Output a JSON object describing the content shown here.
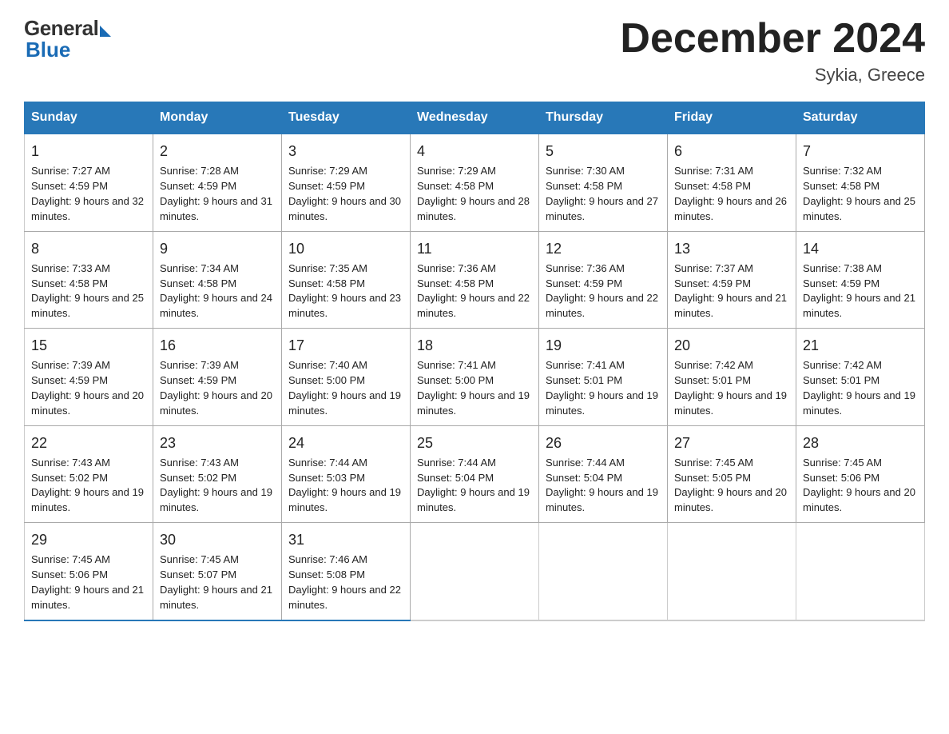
{
  "logo": {
    "general": "General",
    "blue": "Blue"
  },
  "title": "December 2024",
  "location": "Sykia, Greece",
  "days_of_week": [
    "Sunday",
    "Monday",
    "Tuesday",
    "Wednesday",
    "Thursday",
    "Friday",
    "Saturday"
  ],
  "weeks": [
    [
      {
        "day": "1",
        "sunrise": "Sunrise: 7:27 AM",
        "sunset": "Sunset: 4:59 PM",
        "daylight": "Daylight: 9 hours and 32 minutes."
      },
      {
        "day": "2",
        "sunrise": "Sunrise: 7:28 AM",
        "sunset": "Sunset: 4:59 PM",
        "daylight": "Daylight: 9 hours and 31 minutes."
      },
      {
        "day": "3",
        "sunrise": "Sunrise: 7:29 AM",
        "sunset": "Sunset: 4:59 PM",
        "daylight": "Daylight: 9 hours and 30 minutes."
      },
      {
        "day": "4",
        "sunrise": "Sunrise: 7:29 AM",
        "sunset": "Sunset: 4:58 PM",
        "daylight": "Daylight: 9 hours and 28 minutes."
      },
      {
        "day": "5",
        "sunrise": "Sunrise: 7:30 AM",
        "sunset": "Sunset: 4:58 PM",
        "daylight": "Daylight: 9 hours and 27 minutes."
      },
      {
        "day": "6",
        "sunrise": "Sunrise: 7:31 AM",
        "sunset": "Sunset: 4:58 PM",
        "daylight": "Daylight: 9 hours and 26 minutes."
      },
      {
        "day": "7",
        "sunrise": "Sunrise: 7:32 AM",
        "sunset": "Sunset: 4:58 PM",
        "daylight": "Daylight: 9 hours and 25 minutes."
      }
    ],
    [
      {
        "day": "8",
        "sunrise": "Sunrise: 7:33 AM",
        "sunset": "Sunset: 4:58 PM",
        "daylight": "Daylight: 9 hours and 25 minutes."
      },
      {
        "day": "9",
        "sunrise": "Sunrise: 7:34 AM",
        "sunset": "Sunset: 4:58 PM",
        "daylight": "Daylight: 9 hours and 24 minutes."
      },
      {
        "day": "10",
        "sunrise": "Sunrise: 7:35 AM",
        "sunset": "Sunset: 4:58 PM",
        "daylight": "Daylight: 9 hours and 23 minutes."
      },
      {
        "day": "11",
        "sunrise": "Sunrise: 7:36 AM",
        "sunset": "Sunset: 4:58 PM",
        "daylight": "Daylight: 9 hours and 22 minutes."
      },
      {
        "day": "12",
        "sunrise": "Sunrise: 7:36 AM",
        "sunset": "Sunset: 4:59 PM",
        "daylight": "Daylight: 9 hours and 22 minutes."
      },
      {
        "day": "13",
        "sunrise": "Sunrise: 7:37 AM",
        "sunset": "Sunset: 4:59 PM",
        "daylight": "Daylight: 9 hours and 21 minutes."
      },
      {
        "day": "14",
        "sunrise": "Sunrise: 7:38 AM",
        "sunset": "Sunset: 4:59 PM",
        "daylight": "Daylight: 9 hours and 21 minutes."
      }
    ],
    [
      {
        "day": "15",
        "sunrise": "Sunrise: 7:39 AM",
        "sunset": "Sunset: 4:59 PM",
        "daylight": "Daylight: 9 hours and 20 minutes."
      },
      {
        "day": "16",
        "sunrise": "Sunrise: 7:39 AM",
        "sunset": "Sunset: 4:59 PM",
        "daylight": "Daylight: 9 hours and 20 minutes."
      },
      {
        "day": "17",
        "sunrise": "Sunrise: 7:40 AM",
        "sunset": "Sunset: 5:00 PM",
        "daylight": "Daylight: 9 hours and 19 minutes."
      },
      {
        "day": "18",
        "sunrise": "Sunrise: 7:41 AM",
        "sunset": "Sunset: 5:00 PM",
        "daylight": "Daylight: 9 hours and 19 minutes."
      },
      {
        "day": "19",
        "sunrise": "Sunrise: 7:41 AM",
        "sunset": "Sunset: 5:01 PM",
        "daylight": "Daylight: 9 hours and 19 minutes."
      },
      {
        "day": "20",
        "sunrise": "Sunrise: 7:42 AM",
        "sunset": "Sunset: 5:01 PM",
        "daylight": "Daylight: 9 hours and 19 minutes."
      },
      {
        "day": "21",
        "sunrise": "Sunrise: 7:42 AM",
        "sunset": "Sunset: 5:01 PM",
        "daylight": "Daylight: 9 hours and 19 minutes."
      }
    ],
    [
      {
        "day": "22",
        "sunrise": "Sunrise: 7:43 AM",
        "sunset": "Sunset: 5:02 PM",
        "daylight": "Daylight: 9 hours and 19 minutes."
      },
      {
        "day": "23",
        "sunrise": "Sunrise: 7:43 AM",
        "sunset": "Sunset: 5:02 PM",
        "daylight": "Daylight: 9 hours and 19 minutes."
      },
      {
        "day": "24",
        "sunrise": "Sunrise: 7:44 AM",
        "sunset": "Sunset: 5:03 PM",
        "daylight": "Daylight: 9 hours and 19 minutes."
      },
      {
        "day": "25",
        "sunrise": "Sunrise: 7:44 AM",
        "sunset": "Sunset: 5:04 PM",
        "daylight": "Daylight: 9 hours and 19 minutes."
      },
      {
        "day": "26",
        "sunrise": "Sunrise: 7:44 AM",
        "sunset": "Sunset: 5:04 PM",
        "daylight": "Daylight: 9 hours and 19 minutes."
      },
      {
        "day": "27",
        "sunrise": "Sunrise: 7:45 AM",
        "sunset": "Sunset: 5:05 PM",
        "daylight": "Daylight: 9 hours and 20 minutes."
      },
      {
        "day": "28",
        "sunrise": "Sunrise: 7:45 AM",
        "sunset": "Sunset: 5:06 PM",
        "daylight": "Daylight: 9 hours and 20 minutes."
      }
    ],
    [
      {
        "day": "29",
        "sunrise": "Sunrise: 7:45 AM",
        "sunset": "Sunset: 5:06 PM",
        "daylight": "Daylight: 9 hours and 21 minutes."
      },
      {
        "day": "30",
        "sunrise": "Sunrise: 7:45 AM",
        "sunset": "Sunset: 5:07 PM",
        "daylight": "Daylight: 9 hours and 21 minutes."
      },
      {
        "day": "31",
        "sunrise": "Sunrise: 7:46 AM",
        "sunset": "Sunset: 5:08 PM",
        "daylight": "Daylight: 9 hours and 22 minutes."
      },
      null,
      null,
      null,
      null
    ]
  ]
}
